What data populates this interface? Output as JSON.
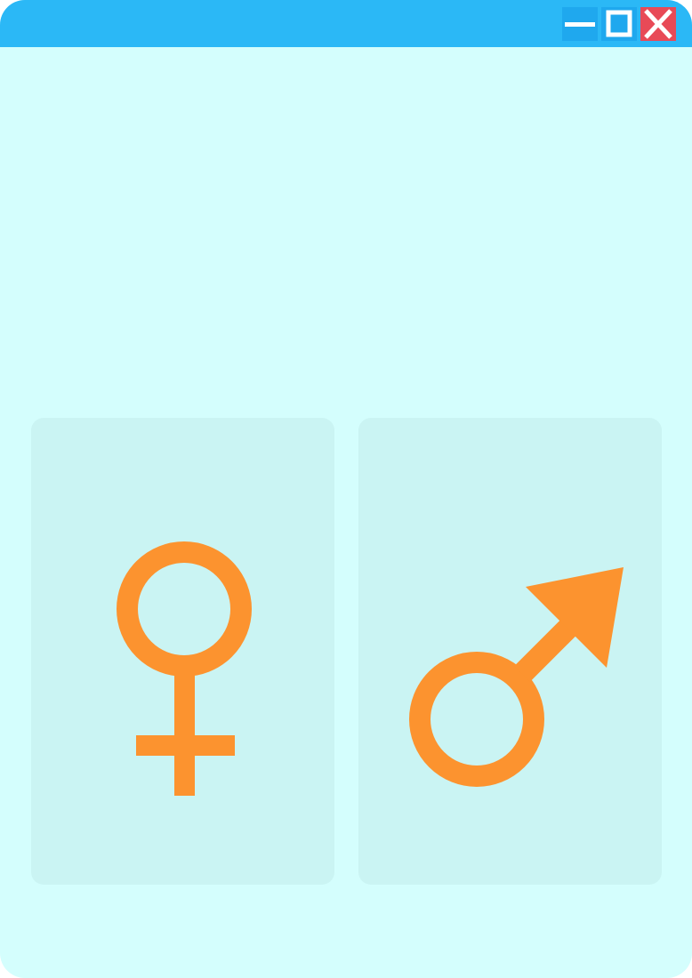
{
  "colors": {
    "window_background": "#d4fefd",
    "titlebar": "#2bb8f6",
    "window_button": "#1fa8ee",
    "close_button": "#e84a57",
    "card_background": "#caf4f3",
    "symbol": "#fc932f"
  },
  "titlebar": {
    "buttons": [
      {
        "icon": "minimize-icon"
      },
      {
        "icon": "maximize-icon"
      },
      {
        "icon": "close-icon"
      }
    ]
  },
  "options": [
    {
      "icon": "female-symbol-icon"
    },
    {
      "icon": "male-symbol-icon"
    }
  ]
}
